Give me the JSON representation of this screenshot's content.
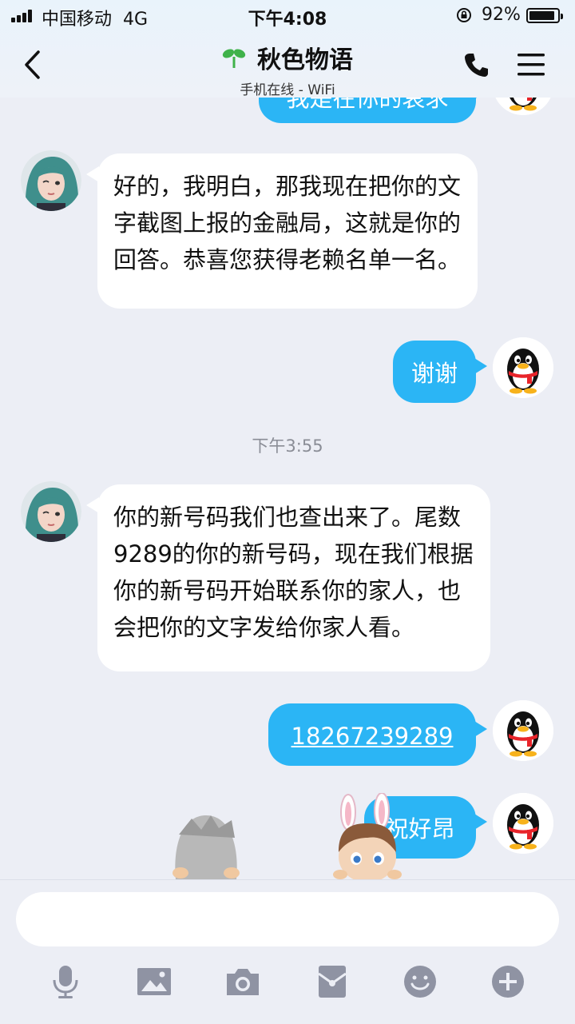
{
  "status_bar": {
    "carrier": "中国移动",
    "network": "4G",
    "time": "下午4:08",
    "battery_percent": "92%",
    "battery_level": 0.92
  },
  "header": {
    "title": "秋色物语",
    "subtitle": "手机在线 - WiFi",
    "icons": [
      "back-icon",
      "sprout-icon",
      "phone-icon",
      "menu-icon"
    ]
  },
  "messages": [
    {
      "side": "right",
      "text": "我是在你的哀求"
    },
    {
      "side": "left",
      "text": "好的，我明白，那我现在把你的文字截图上报的金融局，这就是你的回答。恭喜您获得老赖名单一名。"
    },
    {
      "side": "right",
      "text": "谢谢"
    },
    {
      "type": "timestamp",
      "text": "下午3:55"
    },
    {
      "side": "left",
      "text": "你的新号码我们也查出来了。尾数9289的你的新号码，现在我们根据你的新号码开始联系你的家人，也会把你的文字发给你家人看。"
    },
    {
      "side": "right",
      "text": "18267239289",
      "link": true
    },
    {
      "side": "right",
      "text": "祝好昂"
    }
  ],
  "input_bar": {
    "placeholder": "",
    "tools": [
      "microphone-icon",
      "image-icon",
      "camera-icon",
      "red-packet-icon",
      "emoji-icon",
      "plus-icon"
    ]
  },
  "colors": {
    "accent": "#2bb5f5",
    "background": "#eceef5"
  }
}
